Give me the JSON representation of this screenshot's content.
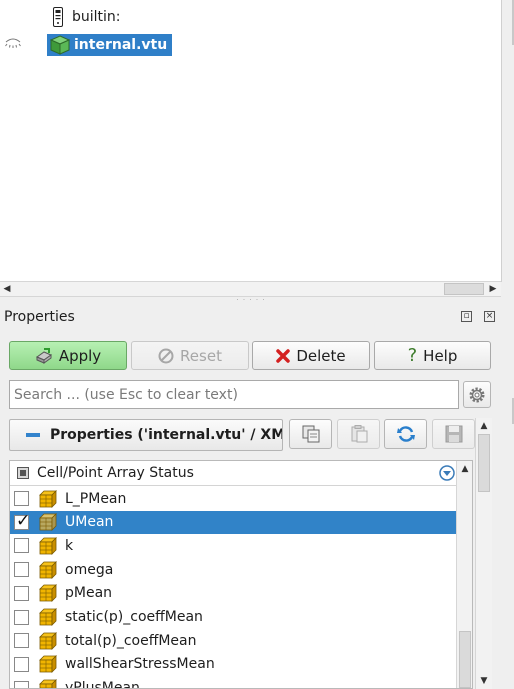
{
  "pipeline": {
    "items": [
      {
        "label": "builtin:"
      },
      {
        "label": "internal.vtu"
      }
    ]
  },
  "properties_panel": {
    "title": "Properties",
    "buttons": {
      "apply": "Apply",
      "reset": "Reset",
      "delete": "Delete",
      "help": "Help"
    },
    "search_placeholder": "Search ... (use Esc to clear text)",
    "section_title": "Properties ('internal.vtu' / XM",
    "array_table": {
      "header": "Cell/Point Array Status",
      "rows": [
        {
          "label": "L_PMean",
          "checked": false,
          "selected": false
        },
        {
          "label": "UMean",
          "checked": true,
          "selected": true
        },
        {
          "label": "k",
          "checked": false,
          "selected": false
        },
        {
          "label": "omega",
          "checked": false,
          "selected": false
        },
        {
          "label": "pMean",
          "checked": false,
          "selected": false
        },
        {
          "label": "static(p)_coeffMean",
          "checked": false,
          "selected": false
        },
        {
          "label": "total(p)_coeffMean",
          "checked": false,
          "selected": false
        },
        {
          "label": "wallShearStressMean",
          "checked": false,
          "selected": false
        },
        {
          "label": "yPlusMean",
          "checked": false,
          "selected": false
        }
      ]
    }
  },
  "colors": {
    "selection": "#3183c8",
    "apply_green": "#8fd88a",
    "delete_red": "#d42020",
    "refresh_blue": "#2a7fcc"
  },
  "icons": [
    "builtin-server-icon",
    "dataset-cube-icon",
    "eye-icon",
    "apply-icon",
    "reset-icon",
    "delete-icon",
    "help-icon",
    "gear-icon",
    "copy-icon",
    "paste-icon",
    "refresh-icon",
    "save-icon",
    "filter-icon",
    "array-cube-icon"
  ]
}
